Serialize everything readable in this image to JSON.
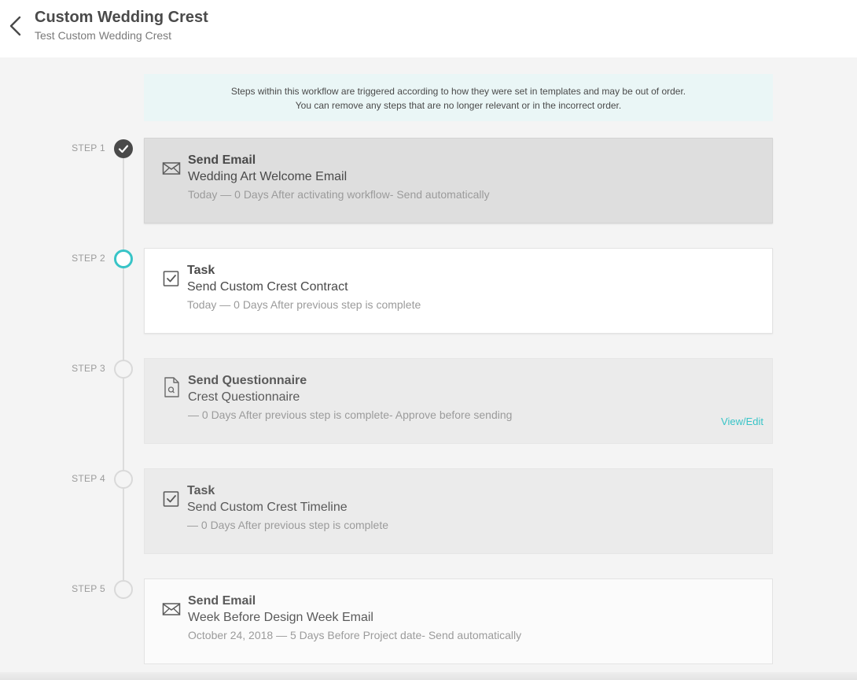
{
  "header": {
    "title": "Custom Wedding Crest",
    "subtitle": "Test Custom Wedding Crest"
  },
  "notice": {
    "line1": "Steps within this workflow are triggered according to how they were set in templates and may be out of order.",
    "line2": "You can remove any steps that are no longer relevant or in the incorrect order."
  },
  "steps": [
    {
      "label": "STEP 1",
      "status": "completed",
      "icon": "envelope-icon",
      "type": "Send Email",
      "name": "Wedding Art Welcome Email",
      "meta": "Today — 0 Days After activating workflow- Send automatically"
    },
    {
      "label": "STEP 2",
      "status": "active",
      "icon": "checkbox-icon",
      "type": "Task",
      "name": "Send Custom Crest Contract",
      "meta": "Today — 0 Days After previous step is complete"
    },
    {
      "label": "STEP 3",
      "status": "pending",
      "icon": "questionnaire-document-icon",
      "type": "Send Questionnaire",
      "name": "Crest Questionnaire",
      "meta": " — 0 Days After previous step is complete- Approve before sending",
      "action": "View/Edit"
    },
    {
      "label": "STEP 4",
      "status": "pending",
      "icon": "checkbox-icon",
      "type": "Task",
      "name": "Send Custom Crest Timeline",
      "meta": " — 0 Days After previous step is complete"
    },
    {
      "label": "STEP 5",
      "status": "pending",
      "icon": "envelope-icon",
      "type": "Send Email",
      "name": "Week Before Design Week Email",
      "meta": "October 24, 2018 — 5 Days Before Project date- Send automatically"
    }
  ],
  "colors": {
    "accent": "#38c4c7",
    "completed_dot": "#4a4a4a",
    "notice_bg": "#eaf6f6"
  }
}
